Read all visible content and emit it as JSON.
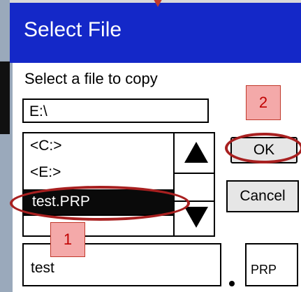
{
  "dialog": {
    "title": "Select File",
    "prompt": "Select a file to copy",
    "path": "E:\\",
    "files": [
      "<C:>",
      "<E:>",
      "test.PRP"
    ],
    "selected_file": "test.PRP",
    "ok_label": "OK",
    "cancel_label": "Cancel",
    "filename": "test",
    "extension_separator": ".",
    "extension": "PRP"
  },
  "annotations": {
    "callout_1": "1",
    "callout_2": "2",
    "highlight_color": "#a82020",
    "callout_fill": "#f4a9a9"
  },
  "colors": {
    "titlebar": "#1428c8",
    "selection": "#0a0a0a",
    "button": "#e6e6e6"
  }
}
